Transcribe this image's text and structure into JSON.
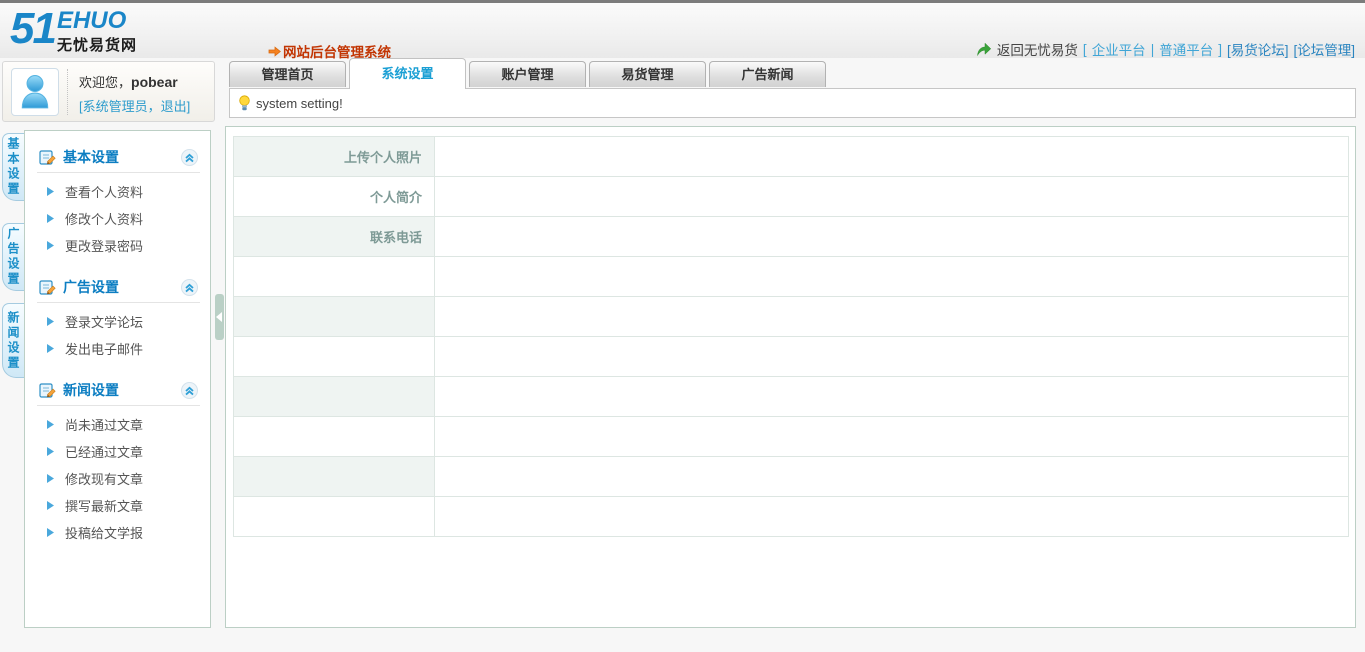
{
  "header": {
    "logo_number": "51",
    "logo_word": "EHUO",
    "logo_subtitle": "无忧易货网",
    "system_title": "网站后台管理系统",
    "nav": {
      "back": "返回无忧易货",
      "bracket_open": "[",
      "enterprise": "企业平台",
      "divider": "|",
      "general": "普通平台",
      "bracket_close": "]",
      "forum": "[易货论坛]",
      "forum_admin": "[论坛管理]"
    }
  },
  "user_panel": {
    "welcome_prefix": "欢迎您，",
    "username": "pobear",
    "role_line": "[系统管理员，退出]"
  },
  "tabs": [
    "管理首页",
    "系统设置",
    "账户管理",
    "易货管理",
    "广告新闻"
  ],
  "active_tab": "系统设置",
  "notice": {
    "message": "system setting!"
  },
  "sidebar": {
    "vertical_tabs": [
      "基本设置",
      "广告设置",
      "新闻设置"
    ],
    "sections": [
      {
        "title": "基本设置",
        "items": [
          "查看个人资料",
          "修改个人资料",
          "更改登录密码"
        ]
      },
      {
        "title": "广告设置",
        "items": [
          "登录文学论坛",
          "发出电子邮件"
        ]
      },
      {
        "title": "新闻设置",
        "items": [
          "尚未通过文章",
          "已经通过文章",
          "修改现有文章",
          "撰写最新文章",
          "投稿给文学报"
        ]
      }
    ]
  },
  "form_table": {
    "rows": [
      "上传个人照片",
      "个人简介",
      "联系电话",
      "",
      "",
      "",
      "",
      "",
      "",
      ""
    ]
  },
  "colors": {
    "accent_blue": "#1a9fd4",
    "logo_blue": "#1a86c8",
    "title_red": "#c23503",
    "link_light_blue": "#3fa5d6",
    "link_blue": "#2b85c0",
    "label_green": "#7e9a96",
    "panel_border": "#bccfc5"
  }
}
